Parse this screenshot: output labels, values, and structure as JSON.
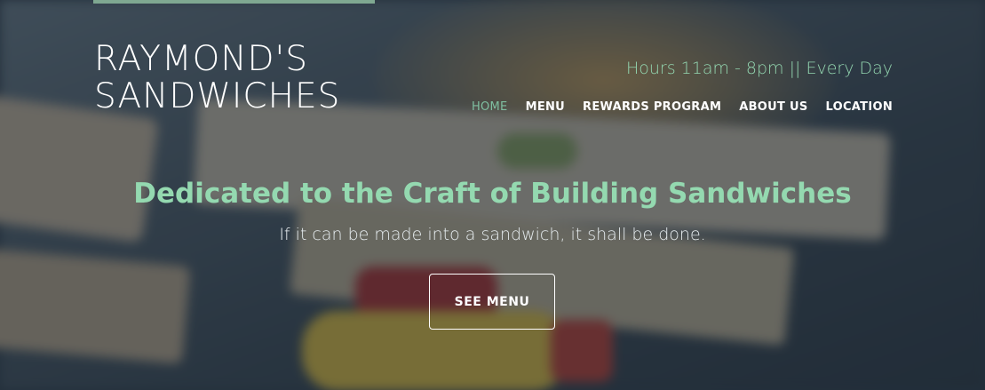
{
  "brand": {
    "line1": "RAYMOND'S",
    "line2": "SANDWICHES",
    "accent_color": "#7fa891"
  },
  "header": {
    "hours": "Hours 11am - 8pm || Every Day"
  },
  "nav": {
    "items": [
      {
        "label": "HOME",
        "active": true
      },
      {
        "label": "MENU",
        "active": false
      },
      {
        "label": "REWARDS PROGRAM",
        "active": false
      },
      {
        "label": "ABOUT US",
        "active": false
      },
      {
        "label": "LOCATION",
        "active": false
      }
    ]
  },
  "hero": {
    "headline": "Dedicated to the Craft of Building Sandwiches",
    "subline": "If it can be made into a sandwich, it shall be done.",
    "cta_label": "SEE MENU",
    "headline_color": "#94d9b0"
  }
}
